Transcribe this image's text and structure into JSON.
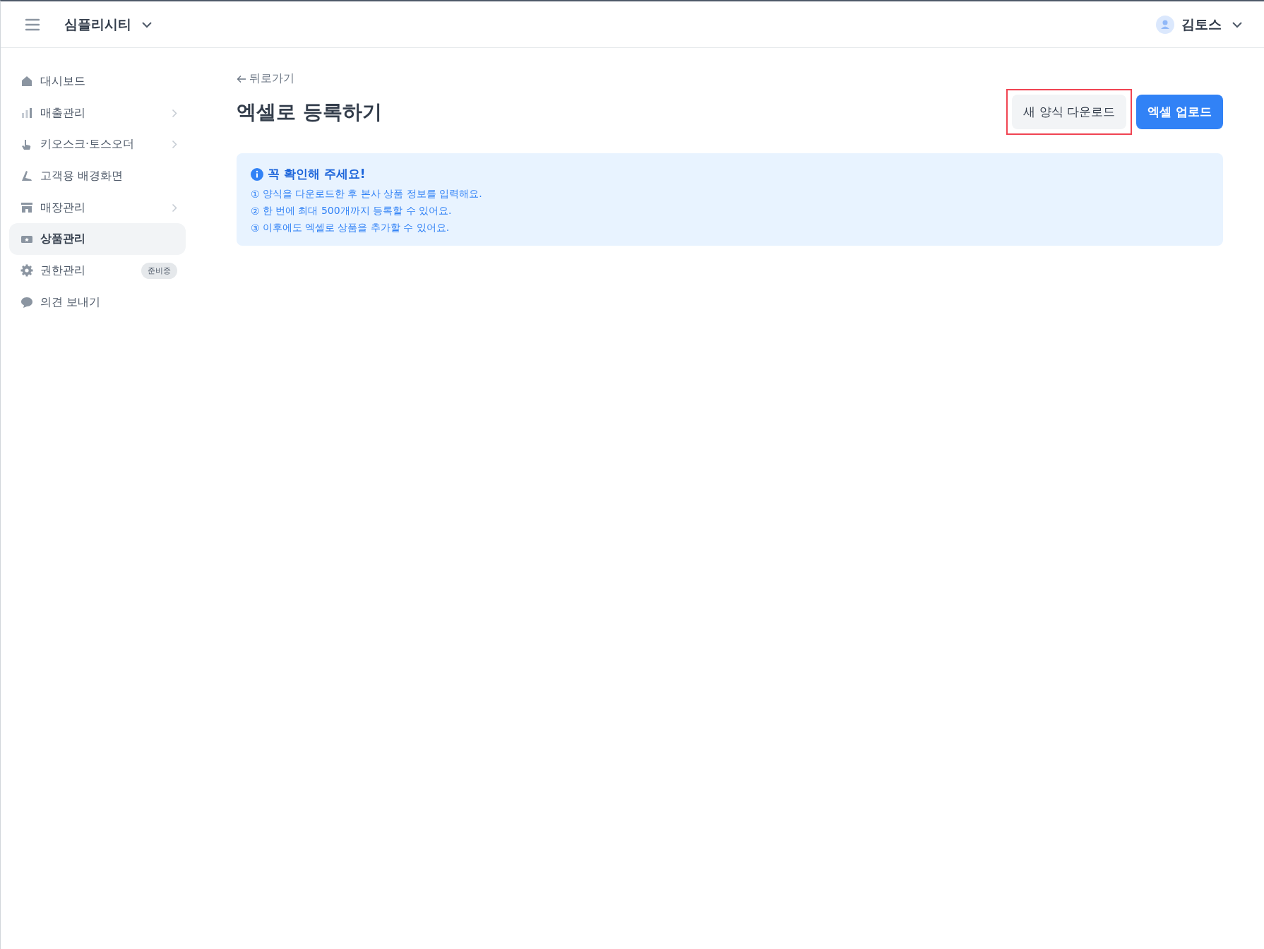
{
  "top_bar": {
    "store_name": "심플리시티",
    "user_name": "김토스"
  },
  "sidebar": {
    "items": [
      {
        "label": "대시보드",
        "selected": false,
        "has_submenu": false
      },
      {
        "label": "매출관리",
        "selected": false,
        "has_submenu": true
      },
      {
        "label": "키오스크·토스오더",
        "selected": false,
        "has_submenu": true
      },
      {
        "label": "고객용 배경화면",
        "selected": false,
        "has_submenu": false
      },
      {
        "label": "매장관리",
        "selected": false,
        "has_submenu": true
      },
      {
        "label": "상품관리",
        "selected": true,
        "has_submenu": false
      },
      {
        "label": "권한관리",
        "selected": false,
        "has_submenu": false,
        "badge": "준비중"
      },
      {
        "label": "의견 보내기",
        "selected": false,
        "has_submenu": false
      }
    ]
  },
  "page": {
    "back_link": "뒤로가기",
    "title": "엑셀로 등록하기",
    "buttons": [
      {
        "label": "새 양식 다운로드",
        "kind": "secondary",
        "highlighted": true
      },
      {
        "label": "엑셀 업로드",
        "kind": "primary",
        "highlighted": false
      }
    ],
    "notice": {
      "title": "꼭 확인해 주세요!",
      "lines": [
        {
          "number": "①",
          "text": "양식을 다운로드한 후 본사 상품 정보를 입력해요."
        },
        {
          "number": "②",
          "text": "한 번에 최대 500개까지 등록할 수 있어요."
        },
        {
          "number": "③",
          "text": "이후에도 엑셀로 상품을 추가할 수 있어요."
        }
      ]
    }
  }
}
